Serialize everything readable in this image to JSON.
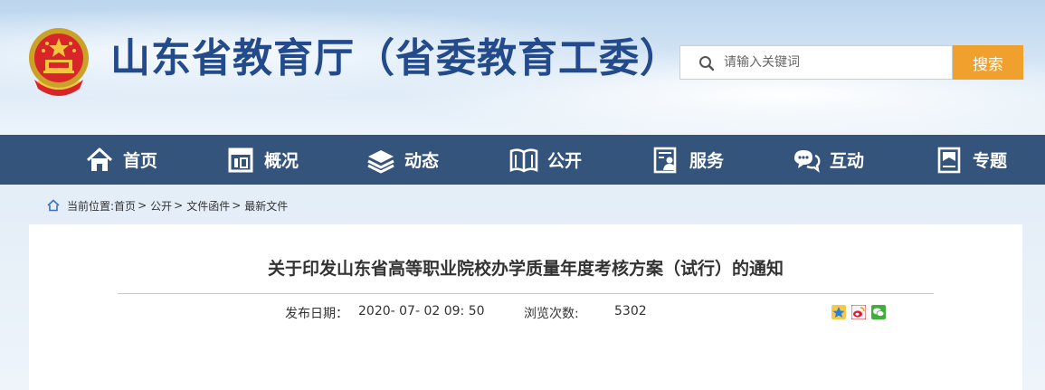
{
  "header": {
    "site_title": "山东省教育厅（省委教育工委）",
    "emblem_icon": "national-emblem-icon"
  },
  "search": {
    "placeholder": "请输入关键词",
    "value": "",
    "button_label": "搜索",
    "icon": "search-icon",
    "button_color": "#f0a02d"
  },
  "nav": {
    "background": "#34547c",
    "items": [
      {
        "label": "首页",
        "icon": "home-icon"
      },
      {
        "label": "概况",
        "icon": "overview-icon"
      },
      {
        "label": "动态",
        "icon": "news-stack-icon"
      },
      {
        "label": "公开",
        "icon": "open-book-icon"
      },
      {
        "label": "服务",
        "icon": "service-person-icon"
      },
      {
        "label": "互动",
        "icon": "chat-bubbles-icon"
      },
      {
        "label": "专题",
        "icon": "bookmark-icon"
      }
    ]
  },
  "breadcrumb": {
    "prefix": "当前位置:",
    "items": [
      "首页",
      "公开",
      "文件函件",
      "最新文件"
    ],
    "separator": ">"
  },
  "article": {
    "title": "关于印发山东省高等职业院校办学质量年度考核方案（试行）的通知",
    "publish_label": "发布日期：",
    "publish_date": "2020- 07- 02 09: 50",
    "views_label": "浏览次数:",
    "views": "5302",
    "share_icons": [
      "qzone-icon",
      "weibo-icon",
      "wechat-icon"
    ]
  }
}
